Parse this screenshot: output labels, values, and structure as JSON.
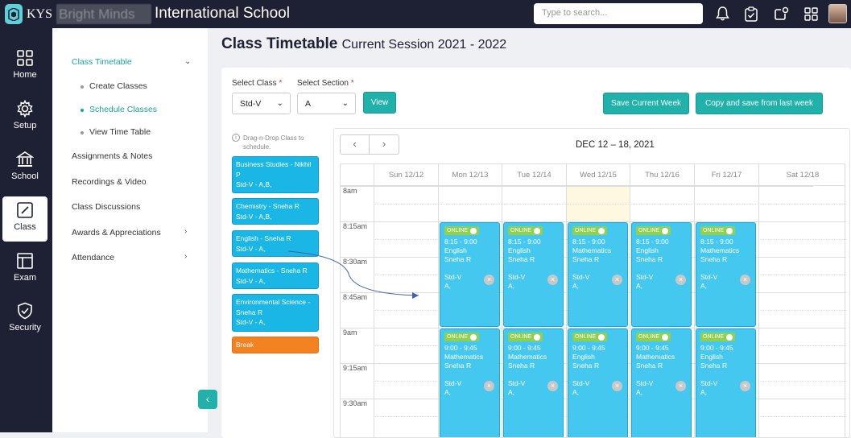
{
  "header": {
    "logo_text": "KYS",
    "school_blurred": "Bright Minds",
    "school_name": "International School",
    "search_placeholder": "Type to search..."
  },
  "nav": [
    {
      "label": "Home",
      "icon": "home-grid-icon"
    },
    {
      "label": "Setup",
      "icon": "gear-icon"
    },
    {
      "label": "School",
      "icon": "school-building-icon"
    },
    {
      "label": "Class",
      "icon": "edit-square-icon",
      "active": true
    },
    {
      "label": "Exam",
      "icon": "exam-layout-icon"
    },
    {
      "label": "Security",
      "icon": "shield-check-icon"
    }
  ],
  "subnav": {
    "section": "Class Timetable",
    "children": [
      "Create Classes",
      "Schedule Classes",
      "View Time Table"
    ],
    "items": [
      "Assignments & Notes",
      "Recordings & Video",
      "Class Discussions",
      "Awards & Appreciations",
      "Attendance"
    ]
  },
  "page": {
    "title": "Class Timetable",
    "subtitle": "Current Session 2021 - 2022"
  },
  "filters": {
    "class_label": "Select Class",
    "class_value": "Std-V",
    "section_label": "Select Section",
    "section_value": "A",
    "required_mark": "*",
    "view_button": "View",
    "save_week_button": "Save Current Week",
    "copy_button": "Copy and save from last week"
  },
  "drag_hint": "Drag-n-Drop Class to schedule.",
  "source_classes": [
    {
      "title": "Business Studies - Nikhil P",
      "sub": "Std-V - A,B,",
      "color": "#1ab6e6"
    },
    {
      "title": "Chemistry - Sneha R",
      "sub": "Std-V - A,B,",
      "color": "#1ab6e6"
    },
    {
      "title": "English - Sneha R",
      "sub": "Std-V - A,",
      "color": "#1ab6e6"
    },
    {
      "title": "Mathematics - Sneha R",
      "sub": "Std-V - A,",
      "color": "#1ab6e6"
    },
    {
      "title": "Environmental Science - Sneha R",
      "sub": "Std-V - A,",
      "color": "#1ab6e6"
    },
    {
      "title": "Break",
      "sub": "",
      "color": "#f58220"
    }
  ],
  "calendar": {
    "range": "DEC 12 – 18, 2021",
    "prev": "‹",
    "next": "›",
    "days": [
      "Sun 12/12",
      "Mon 12/13",
      "Tue 12/14",
      "Wed 12/15",
      "Thu 12/16",
      "Fri 12/17",
      "Sat 12/18"
    ],
    "times": [
      "8am",
      "8:15am",
      "8:30am",
      "8:45am",
      "9am",
      "9:15am",
      "9:30am"
    ],
    "online_label": "ONLINE",
    "remove_label": "×",
    "slot_a": "8:15 - 9:00",
    "slot_b": "9:00 - 9:45",
    "events_a": [
      {
        "subject": "English",
        "teacher": "Sneha R",
        "std": "Std-V",
        "sec": "A,"
      },
      {
        "subject": "English",
        "teacher": "Sneha R",
        "std": "Std-V",
        "sec": "A,"
      },
      {
        "subject": "Mathematics",
        "teacher": "Sneha R",
        "std": "Std-V",
        "sec": "A,"
      },
      {
        "subject": "English",
        "teacher": "Sneha R",
        "std": "Std-V",
        "sec": "A,"
      },
      {
        "subject": "Mathematics",
        "teacher": "Sneha R",
        "std": "Std-V",
        "sec": "A,"
      }
    ],
    "events_b": [
      {
        "subject": "Mathematics",
        "teacher": "Sneha R",
        "std": "Std-V",
        "sec": "A,"
      },
      {
        "subject": "Mathematics",
        "teacher": "Sneha R",
        "std": "Std-V",
        "sec": "A,"
      },
      {
        "subject": "English",
        "teacher": "Sneha R",
        "std": "Std-V",
        "sec": "A,"
      },
      {
        "subject": "Mathematics",
        "teacher": "Sneha R",
        "std": "Std-V",
        "sec": "A,"
      },
      {
        "subject": "English",
        "teacher": "Sneha R",
        "std": "Std-V",
        "sec": "A,"
      }
    ]
  }
}
